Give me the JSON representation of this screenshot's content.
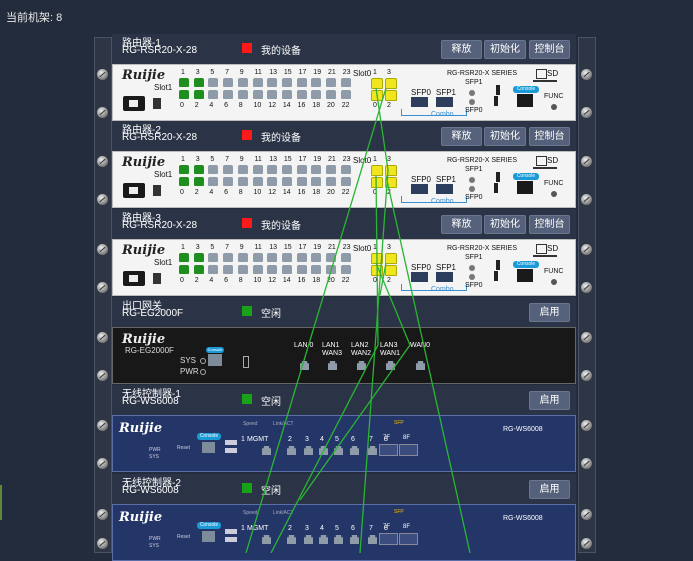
{
  "header": {
    "rack_count": "当前机架: 8"
  },
  "buttons": {
    "release": "释放",
    "init": "初始化",
    "console": "控制台",
    "enable": "启用"
  },
  "status": {
    "mine": "我的设备",
    "free": "空闲",
    "mine_color": "#ff1a1a",
    "free_color": "#17a217"
  },
  "routers": [
    {
      "name": "路由器-1",
      "model": "RG-RSR20-X-28"
    },
    {
      "name": "路由器-2",
      "model": "RG-RSR20-X-28"
    },
    {
      "name": "路由器-3",
      "model": "RG-RSR20-X-28"
    }
  ],
  "router_panel": {
    "brand": "Ruijie",
    "slot1": "Slot1",
    "slot0": "Slot0",
    "series": "RG-RSR20-X SERIES",
    "sd": "SD",
    "top_nums": [
      "1",
      "3",
      "5",
      "7",
      "9",
      "11",
      "13",
      "15",
      "17",
      "19",
      "21",
      "23"
    ],
    "bottom_nums": [
      "0",
      "2",
      "4",
      "6",
      "8",
      "10",
      "12",
      "14",
      "16",
      "18",
      "20",
      "22"
    ],
    "slot0_top": [
      "1",
      "3"
    ],
    "slot0_bottom": [
      "0",
      "2"
    ],
    "sfp0": "SFP0",
    "sfp1": "SFP1",
    "combo": "Combo",
    "console": "Console",
    "func": "FUNC",
    "port_green": "#1e8f1e",
    "port_gray": "#8f9ba8",
    "port_yellow": "#f0e51e"
  },
  "gateway": {
    "name": "出口网关",
    "model": "RG-EG2000F",
    "brand": "Ruijie",
    "panel_model": "RG-EG2000F",
    "sys": "SYS",
    "pwr": "PWR",
    "console": "Console",
    "ports": [
      {
        "top": "LAN 0",
        "bottom": ""
      },
      {
        "top": "LAN1",
        "bottom": "WAN3"
      },
      {
        "top": "LAN2",
        "bottom": "WAN2"
      },
      {
        "top": "LAN3",
        "bottom": "WAN1"
      },
      {
        "top": "WAN0",
        "bottom": ""
      }
    ]
  },
  "controllers": [
    {
      "name": "无线控制器-1",
      "model": "RG-WS6008"
    },
    {
      "name": "无线控制器-2",
      "model": "RG-WS6008"
    }
  ],
  "controller_panel": {
    "brand": "Ruijie",
    "model": "RG-WS6008",
    "speed": "Speed",
    "linkact": "Link/ACT",
    "sfp": "SFP",
    "pwr": "PWR",
    "sys": "SYS",
    "reset": "Reset",
    "console": "Console",
    "mgmt": "MGMT",
    "nums": [
      "1",
      "2",
      "3",
      "4",
      "5",
      "6",
      "7",
      "8"
    ],
    "sfp_ports": [
      "7F",
      "8F"
    ]
  },
  "colors": {
    "cable": "#29b533"
  }
}
